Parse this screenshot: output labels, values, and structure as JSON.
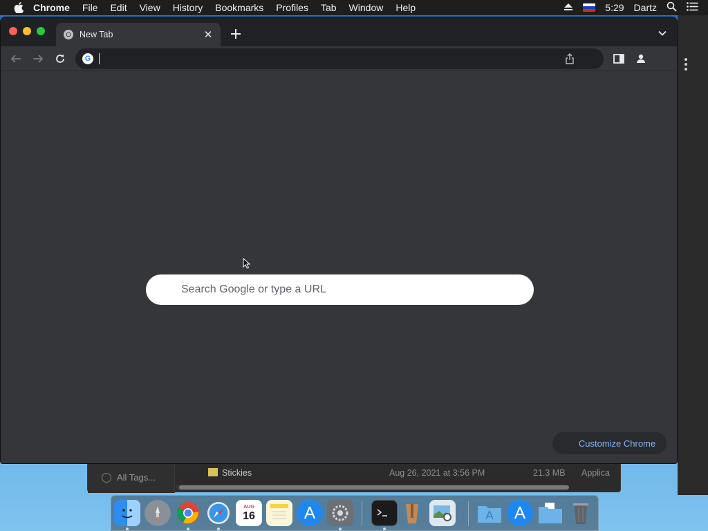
{
  "menubar": {
    "app_name": "Chrome",
    "items": [
      "File",
      "Edit",
      "View",
      "History",
      "Bookmarks",
      "Profiles",
      "Tab",
      "Window",
      "Help"
    ],
    "time": "5:29",
    "user": "Dartz"
  },
  "tab": {
    "title": "New Tab"
  },
  "omnibox": {
    "value": ""
  },
  "newtab_page": {
    "search_placeholder": "Search Google or type a URL",
    "customize_label": "Customize Chrome"
  },
  "background_finder": {
    "sidebar_item": "All Tags...",
    "row": {
      "name": "Stickies",
      "date": "Aug 26, 2021 at 3:56 PM",
      "size": "21.3 MB",
      "kind": "Applica"
    }
  },
  "dock": {
    "calendar_day": "16",
    "calendar_month": "AUG",
    "apps": [
      "Finder",
      "Launchpad",
      "Google Chrome",
      "Safari",
      "Calendar",
      "Notes",
      "App Store",
      "System Preferences",
      "Terminal",
      "Archive Utility",
      "Preview",
      "Applications",
      "App Store Folder",
      "Documents",
      "Trash"
    ]
  },
  "colors": {
    "chrome_frame": "#202124",
    "chrome_toolbar": "#35363a",
    "accent_link": "#8ab4f8",
    "close_red": "#fe5f57",
    "minimize_yellow": "#febc2e",
    "zoom_green": "#28c840"
  }
}
